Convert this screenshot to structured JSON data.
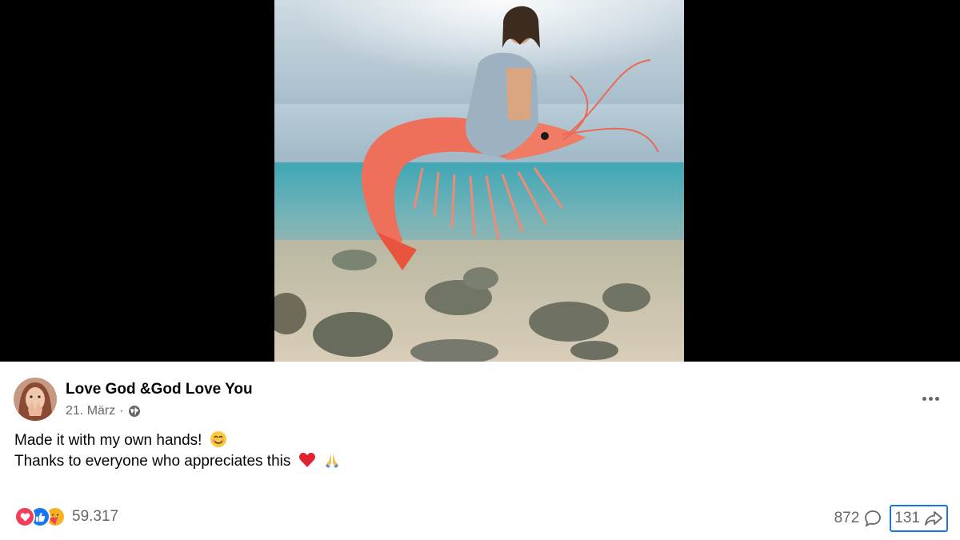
{
  "post": {
    "author": "Love God &God Love You",
    "date": "21. März",
    "date_separator": "·",
    "text_line1": "Made it with my own hands!",
    "text_line2": "Thanks to everyone who appreciates this",
    "image_alt": "Jesus riding a giant shrimp over the sea"
  },
  "engagement": {
    "reaction_count": "59.317",
    "reactions": [
      "love",
      "like",
      "care"
    ],
    "comment_count": "872",
    "share_count": "131"
  },
  "icons": {
    "visibility": "globe-icon",
    "more": "more-options-icon",
    "comment": "comment-icon",
    "share": "share-icon"
  },
  "colors": {
    "like_blue": "#1877f2",
    "love_red": "#f33e58",
    "care_yellow": "#f7b125",
    "focus_outline": "#1b74e4",
    "secondary_text": "#65676b"
  }
}
